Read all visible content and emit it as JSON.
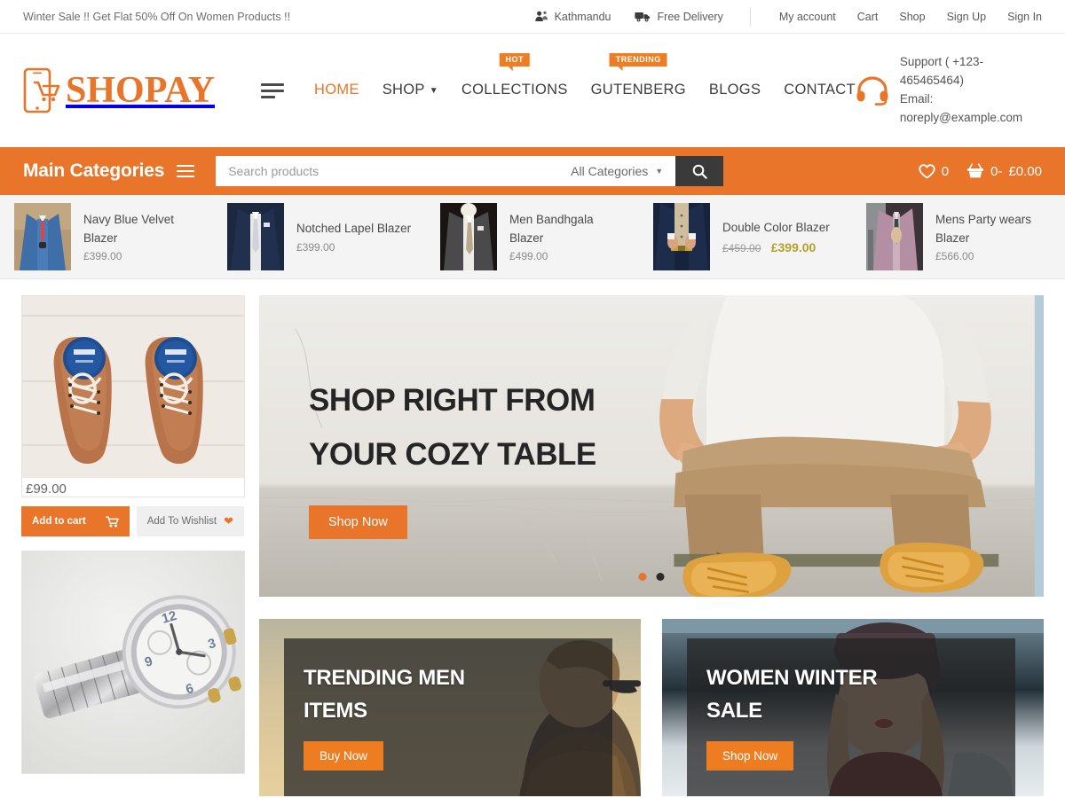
{
  "topbar": {
    "promo_text": "Winter Sale !! Get Flat 50% Off On Women Products !!",
    "location": "Kathmandu",
    "delivery": "Free Delivery",
    "links": [
      "My account",
      "Cart",
      "Shop",
      "Sign Up",
      "Sign In"
    ]
  },
  "header": {
    "logo_text": "SHOPAY",
    "nav": [
      {
        "label": "HOME",
        "active": true,
        "caret": false,
        "badge": null
      },
      {
        "label": "SHOP",
        "active": false,
        "caret": true,
        "badge": null
      },
      {
        "label": "COLLECTIONS",
        "active": false,
        "caret": false,
        "badge": "HOT"
      },
      {
        "label": "GUTENBERG",
        "active": false,
        "caret": false,
        "badge": "TRENDING"
      },
      {
        "label": "BLOGS",
        "active": false,
        "caret": false,
        "badge": null
      },
      {
        "label": "CONTACT",
        "active": false,
        "caret": false,
        "badge": null
      }
    ],
    "support_phone": "Support ( +123-465465464)",
    "support_email": "Email: noreply@example.com"
  },
  "catbar": {
    "title": "Main Categories",
    "search_placeholder": "Search products",
    "search_value": "",
    "category_selected": "All Categories",
    "wishlist_count": "0",
    "cart_count": "0-",
    "cart_total": "£0.00"
  },
  "ticker": [
    {
      "name": "Navy Blue Velvet Blazer",
      "price": "£399.00",
      "old_price": null,
      "sale_price": null
    },
    {
      "name": "Notched Lapel Blazer",
      "price": "£399.00",
      "old_price": null,
      "sale_price": null
    },
    {
      "name": "Men Bandhgala Blazer",
      "price": "£499.00",
      "old_price": null,
      "sale_price": null
    },
    {
      "name": "Double Color Blazer",
      "price": null,
      "old_price": "£459.00",
      "sale_price": "£399.00"
    },
    {
      "name": "Mens Party wears Blazer",
      "price": "£566.00",
      "old_price": null,
      "sale_price": null
    }
  ],
  "sidebar": {
    "product_price": "£99.00",
    "add_to_cart_label": "Add to cart",
    "add_to_wishlist_label": "Add To Wishlist"
  },
  "hero": {
    "line1": "SHOP RIGHT FROM",
    "line2": "YOUR COZY TABLE",
    "button_label": "Shop Now",
    "dots": 2,
    "active_dot": 0
  },
  "promos": [
    {
      "line1": "TRENDING MEN",
      "line2": "ITEMS",
      "button_label": "Buy Now"
    },
    {
      "line1": "WOMEN WINTER",
      "line2": "SALE",
      "button_label": "Shop Now"
    }
  ],
  "colors": {
    "accent": "#E8752A",
    "badge": "#EF7D22",
    "sale_price": "#B3A12B",
    "dark": "#3A3A3A"
  }
}
